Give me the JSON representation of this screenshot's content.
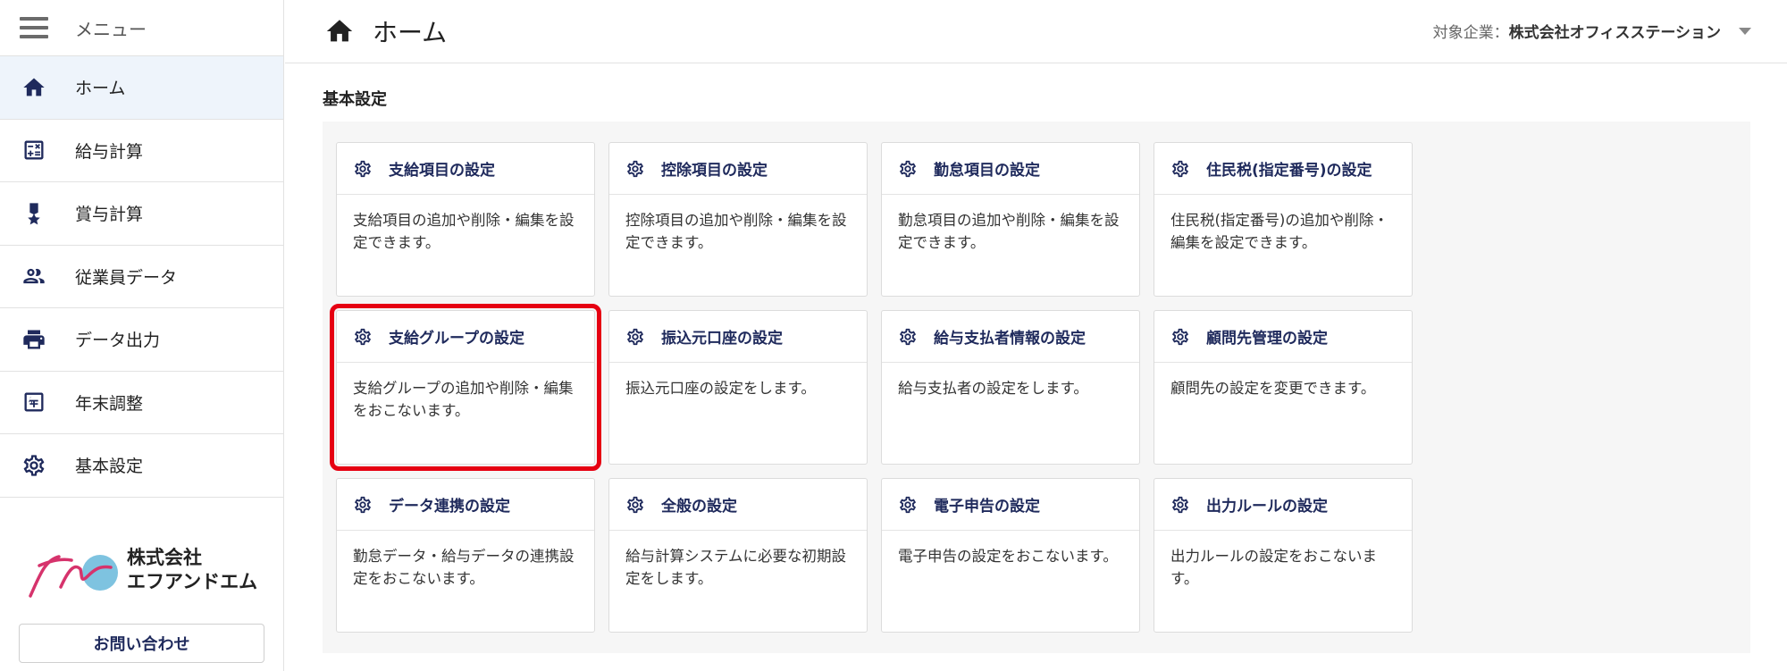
{
  "sidebar": {
    "menu_title": "メニュー",
    "items": [
      {
        "label": "ホーム",
        "icon": "home-icon",
        "active": true
      },
      {
        "label": "給与計算",
        "icon": "calculator-icon"
      },
      {
        "label": "賞与計算",
        "icon": "medal-icon"
      },
      {
        "label": "従業員データ",
        "icon": "people-icon"
      },
      {
        "label": "データ出力",
        "icon": "printer-icon"
      },
      {
        "label": "年末調整",
        "icon": "calendar-year-icon"
      },
      {
        "label": "基本設定",
        "icon": "gear-icon"
      }
    ],
    "logo_line1": "株式会社",
    "logo_line2": "エフアンドエム",
    "contact_label": "お問い合わせ"
  },
  "header": {
    "title": "ホーム",
    "company_label": "対象企業：",
    "company_name": "株式会社オフィスステーション"
  },
  "main": {
    "section_title": "基本設定",
    "cards": [
      {
        "title": "支給項目の設定",
        "desc": "支給項目の追加や削除・編集を設定できます。"
      },
      {
        "title": "控除項目の設定",
        "desc": "控除項目の追加や削除・編集を設定できます。"
      },
      {
        "title": "勤怠項目の設定",
        "desc": "勤怠項目の追加や削除・編集を設定できます。"
      },
      {
        "title": "住民税(指定番号)の設定",
        "desc": "住民税(指定番号)の追加や削除・編集を設定できます。"
      },
      {
        "title": "支給グループの設定",
        "desc": "支給グループの追加や削除・編集をおこないます。",
        "highlighted": true
      },
      {
        "title": "振込元口座の設定",
        "desc": "振込元口座の設定をします。"
      },
      {
        "title": "給与支払者情報の設定",
        "desc": "給与支払者の設定をします。"
      },
      {
        "title": "顧問先管理の設定",
        "desc": "顧問先の設定を変更できます。"
      },
      {
        "title": "データ連携の設定",
        "desc": "勤怠データ・給与データの連携設定をおこないます。"
      },
      {
        "title": "全般の設定",
        "desc": "給与計算システムに必要な初期設定をします。"
      },
      {
        "title": "電子申告の設定",
        "desc": "電子申告の設定をおこないます。"
      },
      {
        "title": "出力ルールの設定",
        "desc": "出力ルールの設定をおこないます。"
      }
    ]
  },
  "colors": {
    "accent": "#1f2a5c",
    "highlight_border": "#e60012",
    "active_nav_bg": "#eef4fb",
    "logo_circle": "#7ec3e0",
    "logo_stroke": "#d6336c"
  }
}
